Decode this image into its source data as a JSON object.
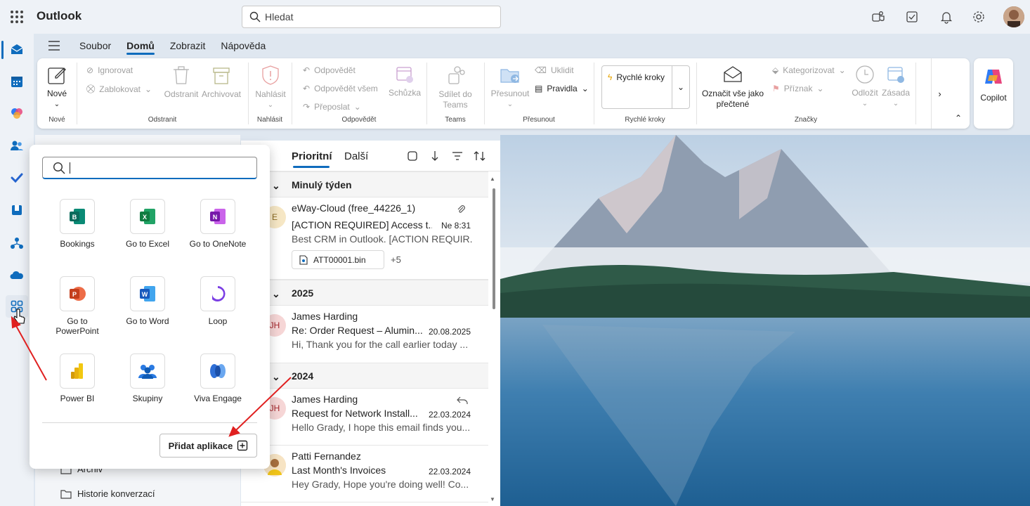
{
  "app": {
    "title": "Outlook"
  },
  "search": {
    "placeholder": "Hledat"
  },
  "menu": {
    "tabs": [
      "Soubor",
      "Domů",
      "Zobrazit",
      "Nápověda"
    ],
    "active": "Domů"
  },
  "ribbon": {
    "new": "Nové",
    "ignore": "Ignorovat",
    "block": "Zablokovat",
    "delete": "Odstranit",
    "archive": "Archivovat",
    "report": "Nahlásit",
    "reply": "Odpovědět",
    "reply_all": "Odpovědět všem",
    "forward": "Přeposlat",
    "meeting": "Schůzka",
    "share_teams": "Sdílet do Teams",
    "move": "Přesunout",
    "sweep": "Uklidit",
    "rules": "Pravidla",
    "quick_steps": "Rychlé kroky",
    "mark_all_read": "Označit vše jako přečtené",
    "categorize": "Kategorizovat",
    "flag": "Příznak",
    "snooze": "Odložit",
    "policy": "Zásada",
    "groups": {
      "new": "Nové",
      "delete": "Odstranit",
      "report": "Nahlásit",
      "respond": "Odpovědět",
      "teams": "Teams",
      "move": "Přesunout",
      "quick_steps": "Rychlé kroky",
      "tags": "Značky"
    },
    "copilot": "Copilot"
  },
  "message_list": {
    "tabs": [
      "Prioritní",
      "Další"
    ],
    "active_tab": "Prioritní",
    "sections": [
      {
        "title": "Minulý týden"
      },
      {
        "title": "2025"
      },
      {
        "title": "2024"
      }
    ],
    "messages": [
      {
        "initials": "E",
        "from": "eWay-Cloud (free_44226_1)",
        "subject": "[ACTION REQUIRED] Access t...",
        "date": "Ne 8:31",
        "preview": "Best CRM in Outlook. [ACTION REQUIR...",
        "attachment": "ATT00001.bin",
        "more": "+5"
      },
      {
        "initials": "JH",
        "from": "James Harding",
        "subject": "Re: Order Request – Alumin...",
        "date": "20.08.2025",
        "preview": "Hi, Thank you for the call earlier today ..."
      },
      {
        "initials": "JH",
        "from": "James Harding",
        "subject": "Request for Network Install...",
        "date": "22.03.2024",
        "preview": "Hello Grady, I hope this email finds you..."
      },
      {
        "initials": "",
        "from": "Patti Fernandez",
        "subject": "Last Month's Invoices",
        "date": "22.03.2024",
        "preview": "Hey Grady, Hope you're doing well! Co..."
      }
    ]
  },
  "folders": {
    "archive": "Archiv",
    "history": "Historie konverzací"
  },
  "launcher": {
    "apps": [
      {
        "name": "Bookings",
        "icon": "bookings-icon",
        "color": "#0a7b6d"
      },
      {
        "name": "Go to Excel",
        "icon": "excel-icon",
        "color": "#107c41"
      },
      {
        "name": "Go to OneNote",
        "icon": "onenote-icon",
        "color": "#7719aa"
      },
      {
        "name": "Go to PowerPoint",
        "icon": "powerpoint-icon",
        "color": "#c43e1c"
      },
      {
        "name": "Go to Word",
        "icon": "word-icon",
        "color": "#185abd"
      },
      {
        "name": "Loop",
        "icon": "loop-icon",
        "color": "#7b3fe4"
      },
      {
        "name": "Power BI",
        "icon": "powerbi-icon",
        "color": "#f2c811"
      },
      {
        "name": "Skupiny",
        "icon": "groups-icon",
        "color": "#2a7ae2"
      },
      {
        "name": "Viva Engage",
        "icon": "viva-engage-icon",
        "color": "#2f6fd6"
      }
    ],
    "add_apps": "Přidat aplikace"
  },
  "colors": {
    "accent": "#0f6cbd",
    "arrow": "#e02020"
  }
}
